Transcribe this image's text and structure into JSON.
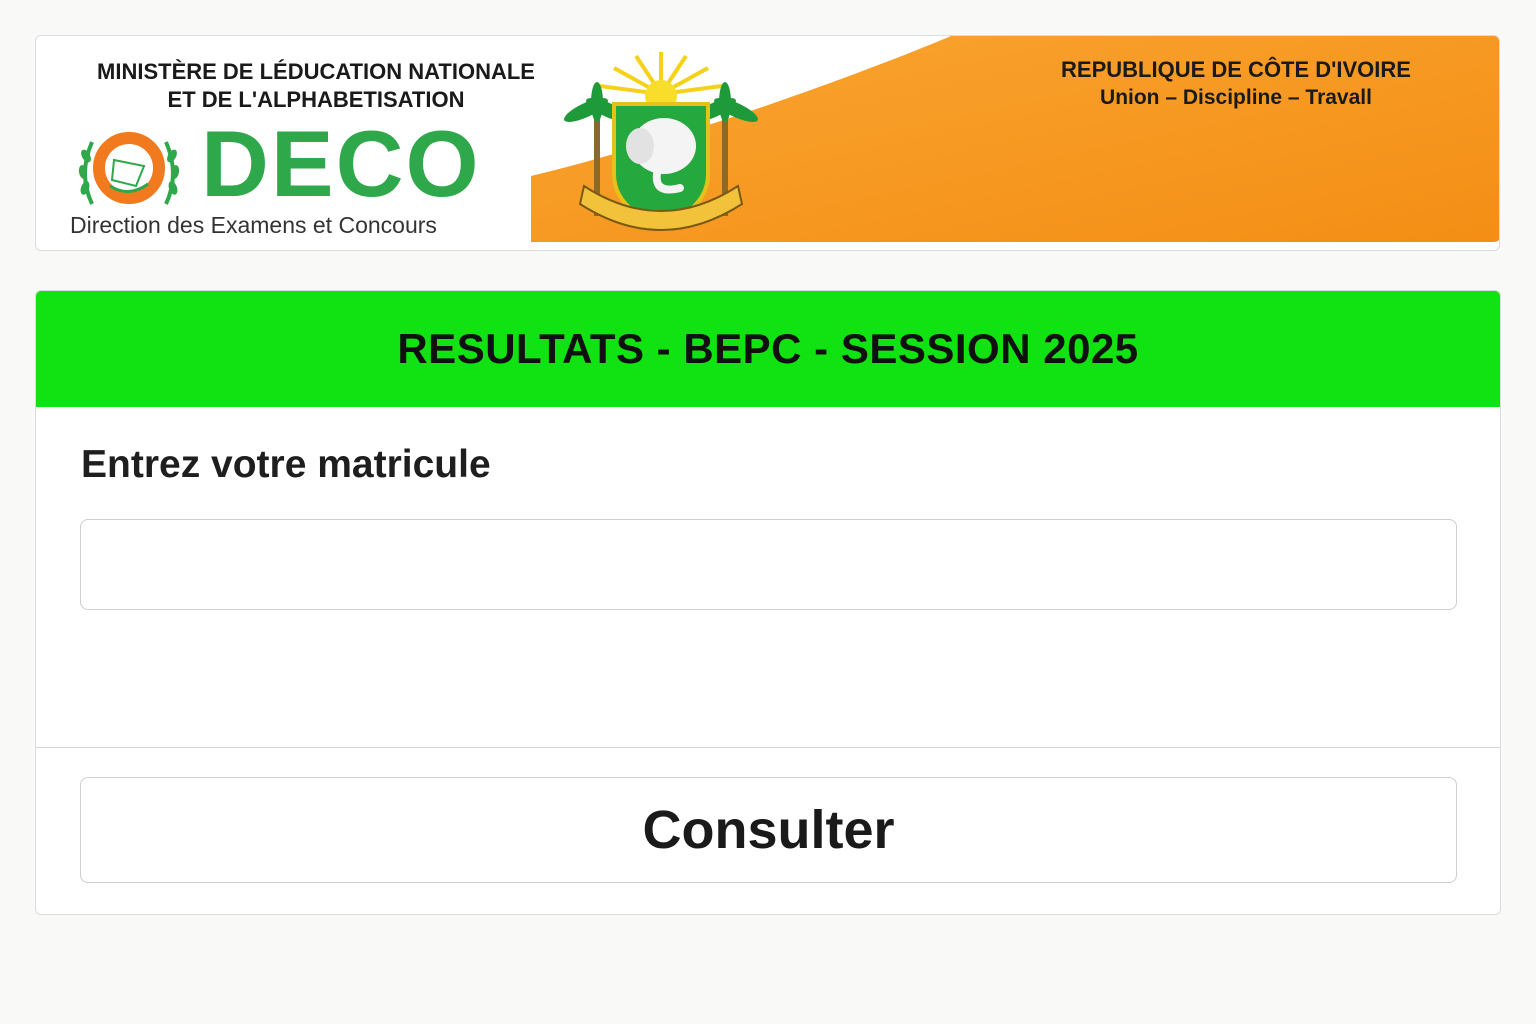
{
  "header": {
    "ministry_line1": "MINISTÈRE DE LÉDUCATION NATIONALE",
    "ministry_line2": "ET DE L'ALPHABETISATION",
    "logo_text": "DECO",
    "logo_subtitle": "Direction des Examens et Concours",
    "country": "REPUBLIQUE DE CÔTE D'IVOIRE",
    "motto": "Union – Discipline – Travall",
    "coat_of_arms_icon": "coat-of-arms-icon",
    "deco_emblem_icon": "deco-emblem-icon"
  },
  "results": {
    "title": "RESULTATS - BEPC - SESSION 2025",
    "field_label": "Entrez votre matricule",
    "input_value": "",
    "button_label": "Consulter"
  },
  "colors": {
    "title_bar": "#11e211",
    "orange_band": "#f7941d",
    "deco_green": "#2ea84a"
  }
}
